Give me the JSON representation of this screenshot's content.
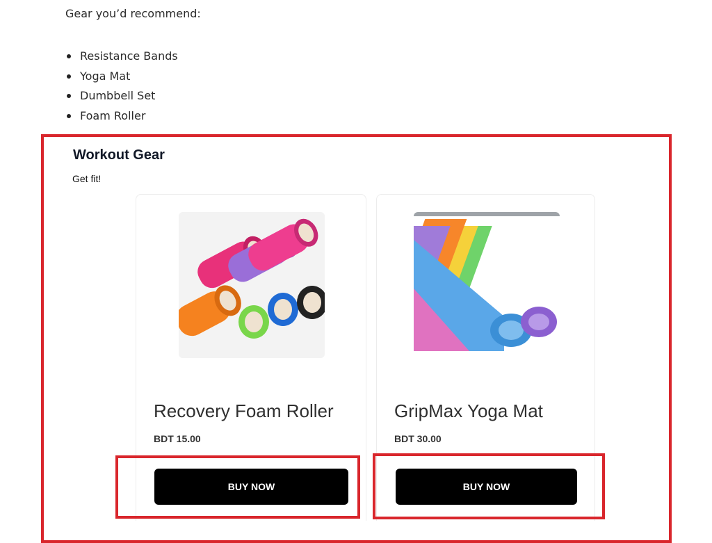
{
  "intro_text": "Gear you’d recommend:",
  "gear_list": [
    "Resistance Bands",
    "Yoga Mat",
    "Dumbbell Set",
    "Foam Roller"
  ],
  "widget": {
    "title": "Workout Gear",
    "subtitle": "Get fit!"
  },
  "products": [
    {
      "name": "Recovery Foam Roller",
      "price": "BDT 15.00",
      "button_label": "BUY NOW",
      "image": "foam-roller-stack-image"
    },
    {
      "name": "GripMax Yoga Mat",
      "price": "BDT 30.00",
      "button_label": "BUY NOW",
      "image": "rolled-yoga-mats-image"
    }
  ],
  "colors": {
    "highlight": "#d9262c",
    "button_bg": "#000000",
    "button_text": "#ffffff"
  }
}
